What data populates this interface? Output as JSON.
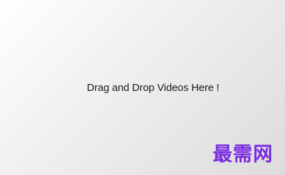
{
  "drop_zone": {
    "label": "Drag and Drop Videos Here !"
  },
  "watermark": {
    "text": "最需网",
    "color": "#7a2be0"
  }
}
